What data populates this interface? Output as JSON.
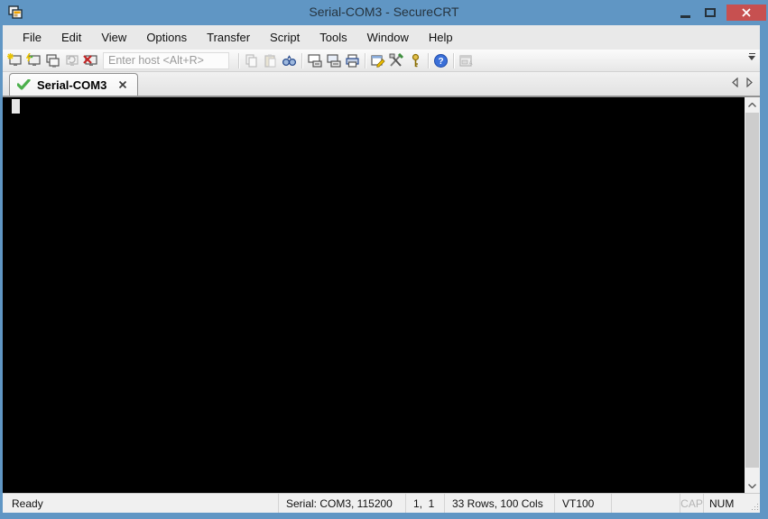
{
  "window": {
    "title": "Serial-COM3 - SecureCRT",
    "accent_color": "#6096c4",
    "close_button_color": "#c75050"
  },
  "menubar": {
    "items": [
      {
        "label": "File"
      },
      {
        "label": "Edit"
      },
      {
        "label": "View"
      },
      {
        "label": "Options"
      },
      {
        "label": "Transfer"
      },
      {
        "label": "Script"
      },
      {
        "label": "Tools"
      },
      {
        "label": "Window"
      },
      {
        "label": "Help"
      }
    ]
  },
  "toolbar": {
    "host_placeholder": "Enter host <Alt+R>",
    "icons": [
      "quick-connect-icon",
      "connect-icon",
      "connect-in-tab-icon",
      "reconnect-icon (disabled)",
      "disconnect-icon",
      "copy-icon (disabled)",
      "paste-icon (disabled)",
      "find-icon",
      "print-screen-icon",
      "auto-print-icon",
      "print-icon",
      "session-options-icon",
      "global-options-icon",
      "key-agent-icon",
      "help-icon",
      "connect-bar-icon (disabled)",
      "toolbar-overflow-icon"
    ]
  },
  "tabs": [
    {
      "label": "Serial-COM3",
      "status": "connected"
    }
  ],
  "terminal": {
    "background": "#000000",
    "cursor": "block"
  },
  "statusbar": {
    "ready": "Ready",
    "serial": "Serial: COM3, 115200",
    "cursor_pos": "1,  1",
    "size": "33 Rows, 100 Cols",
    "emulation": "VT100",
    "cap": "CAP",
    "num": "NUM"
  }
}
